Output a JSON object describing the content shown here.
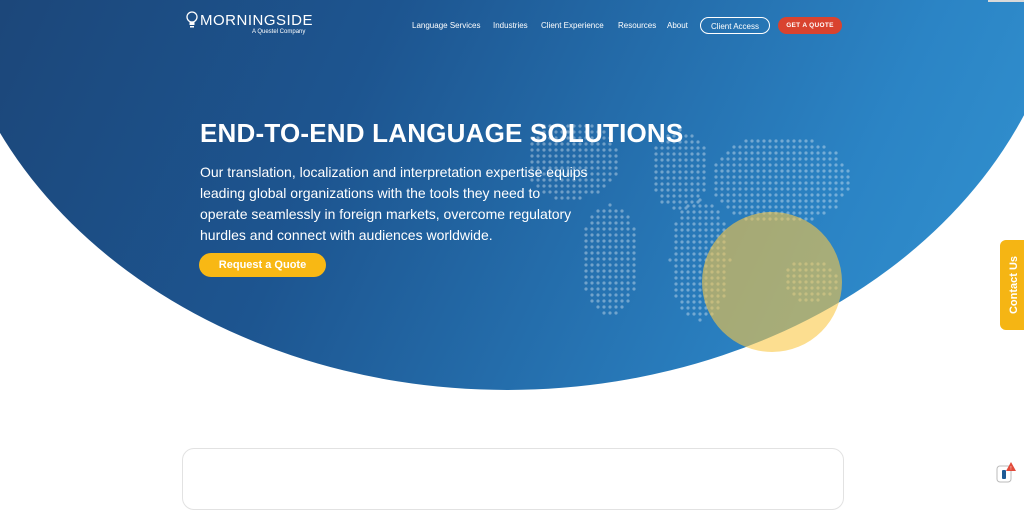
{
  "logo": {
    "name": "MORNINGSIDE",
    "tagline": "A Questel Company"
  },
  "nav": {
    "items": [
      "Language Services",
      "Industries",
      "Client Experience",
      "Resources",
      "About"
    ],
    "client_access": "Client Access",
    "get_quote": "GET A QUOTE"
  },
  "hero": {
    "title": "END-TO-END LANGUAGE SOLUTIONS",
    "description": "Our translation, localization and interpretation expertise equips leading global organizations with the tools they need to operate seamlessly in foreign markets, overcome regulatory hurdles and connect with audiences worldwide.",
    "cta": "Request a Quote"
  },
  "contact_tab": {
    "label": "Contact Us"
  },
  "colors": {
    "hero_dark": "#1b3c69",
    "hero_light": "#3496d3",
    "accent_yellow": "#f8b814",
    "quote_red": "#d9432f"
  },
  "icons": [
    "lightbulb-icon",
    "world-map-dots",
    "chat-alert-icon"
  ]
}
